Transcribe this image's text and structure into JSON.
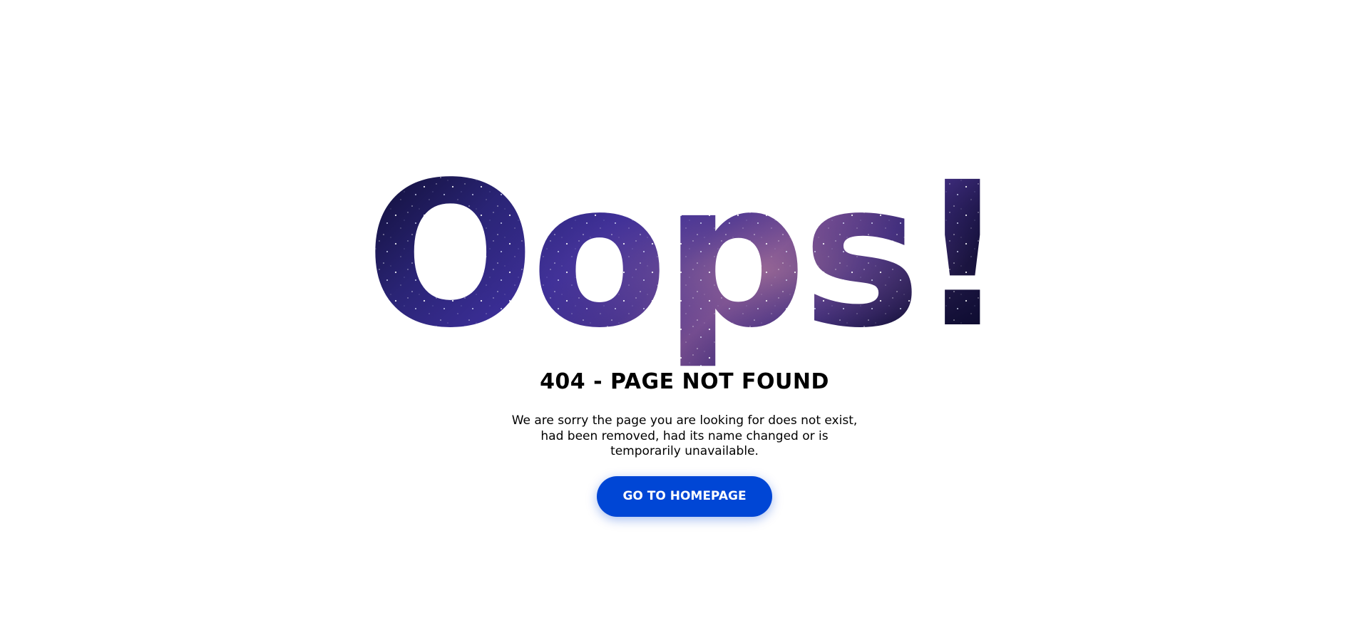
{
  "notfound": {
    "big_text": "Oops!",
    "headline": "404 - Page not found",
    "message": "We are sorry the page you are looking for does not exist, had been removed, had its name changed or is temporarily unavailable.",
    "button_label": "Go To Homepage"
  },
  "colors": {
    "button_bg": "#0046d5",
    "button_text": "#ffffff",
    "headline": "#000000",
    "space_dark": "#0b0a2a",
    "space_mid": "#2a2475",
    "space_violet": "#3d2f9a",
    "space_pink": "#a86a8a"
  }
}
